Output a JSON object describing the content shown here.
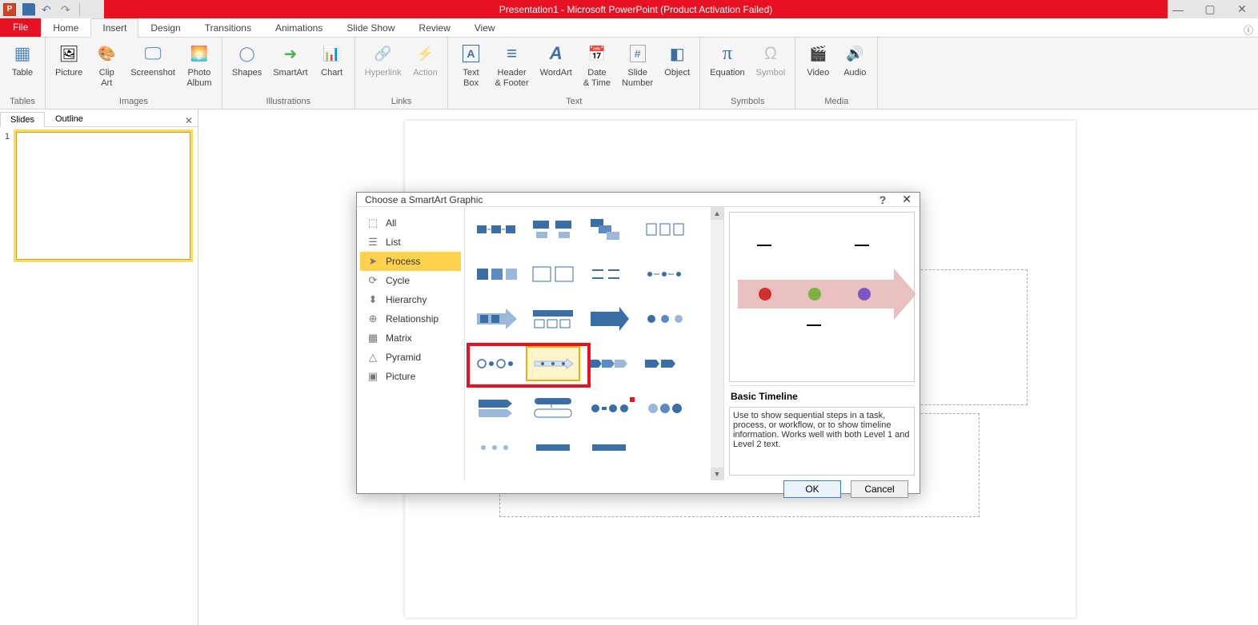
{
  "window": {
    "title": "Presentation1 - Microsoft PowerPoint (Product Activation Failed)"
  },
  "tabs": {
    "file": "File",
    "items": [
      "Home",
      "Insert",
      "Design",
      "Transitions",
      "Animations",
      "Slide Show",
      "Review",
      "View"
    ],
    "active": "Insert"
  },
  "ribbon": {
    "tables": {
      "label": "Tables",
      "table": "Table"
    },
    "images": {
      "label": "Images",
      "picture": "Picture",
      "clipart": "Clip\nArt",
      "screenshot": "Screenshot",
      "album": "Photo\nAlbum"
    },
    "illustrations": {
      "label": "Illustrations",
      "shapes": "Shapes",
      "smartart": "SmartArt",
      "chart": "Chart"
    },
    "links": {
      "label": "Links",
      "hyperlink": "Hyperlink",
      "action": "Action"
    },
    "text": {
      "label": "Text",
      "textbox": "Text\nBox",
      "header": "Header\n& Footer",
      "wordart": "WordArt",
      "date": "Date\n& Time",
      "slidenum": "Slide\nNumber",
      "object": "Object"
    },
    "symbols": {
      "label": "Symbols",
      "equation": "Equation",
      "symbol": "Symbol"
    },
    "media": {
      "label": "Media",
      "video": "Video",
      "audio": "Audio"
    }
  },
  "leftpane": {
    "tabs": {
      "slides": "Slides",
      "outline": "Outline"
    },
    "slide_num": "1"
  },
  "dialog": {
    "title": "Choose a SmartArt Graphic",
    "help": "?",
    "categories": [
      {
        "icon": "⬚",
        "label": "All"
      },
      {
        "icon": "☰",
        "label": "List"
      },
      {
        "icon": "➤",
        "label": "Process"
      },
      {
        "icon": "⟳",
        "label": "Cycle"
      },
      {
        "icon": "⬍",
        "label": "Hierarchy"
      },
      {
        "icon": "⊕",
        "label": "Relationship"
      },
      {
        "icon": "▦",
        "label": "Matrix"
      },
      {
        "icon": "△",
        "label": "Pyramid"
      },
      {
        "icon": "▣",
        "label": "Picture"
      }
    ],
    "selected_category": "Process",
    "preview": {
      "name": "Basic Timeline",
      "desc": "Use to show sequential steps in a task, process, or workflow, or to show timeline information. Works well with both Level 1 and Level 2 text."
    },
    "buttons": {
      "ok": "OK",
      "cancel": "Cancel"
    }
  }
}
